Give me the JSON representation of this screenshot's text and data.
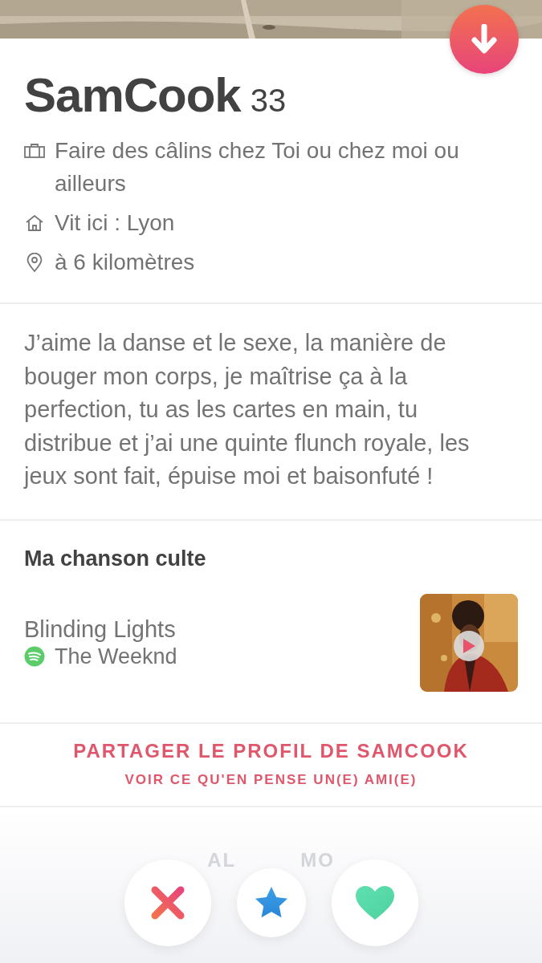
{
  "header": {
    "photo": {
      "kind": "picture"
    }
  },
  "profile": {
    "name": "SamCook",
    "age": "33",
    "details": [
      {
        "kind": "job",
        "text": "Faire des câlins chez Toi ou chez moi ou ailleurs"
      },
      {
        "kind": "home",
        "text": "Vit ici : Lyon"
      },
      {
        "kind": "distance",
        "text": "à 6 kilomètres"
      }
    ]
  },
  "bio": "J’aime la danse et le sexe, la manière de bouger mon corps, je maîtrise ça à la perfection, tu as les cartes en main, tu distribue et j’ai une quinte flunch royale, les jeux sont fait, épuise moi et baisonfuté !",
  "anthem": {
    "title": "Ma chanson culte",
    "song": "Blinding Lights",
    "artist": "The Weeknd",
    "cover": {
      "kind": "picture"
    }
  },
  "share": {
    "title": "PARTAGER LE PROFIL DE SAMCOOK",
    "subtitle": "VOIR CE QU'EN PENSE UN(E) AMI(E)"
  },
  "hidden_text": [
    "AL",
    "MO"
  ],
  "actions": [
    {
      "kind": "nope"
    },
    {
      "kind": "super_like"
    },
    {
      "kind": "like"
    }
  ]
}
